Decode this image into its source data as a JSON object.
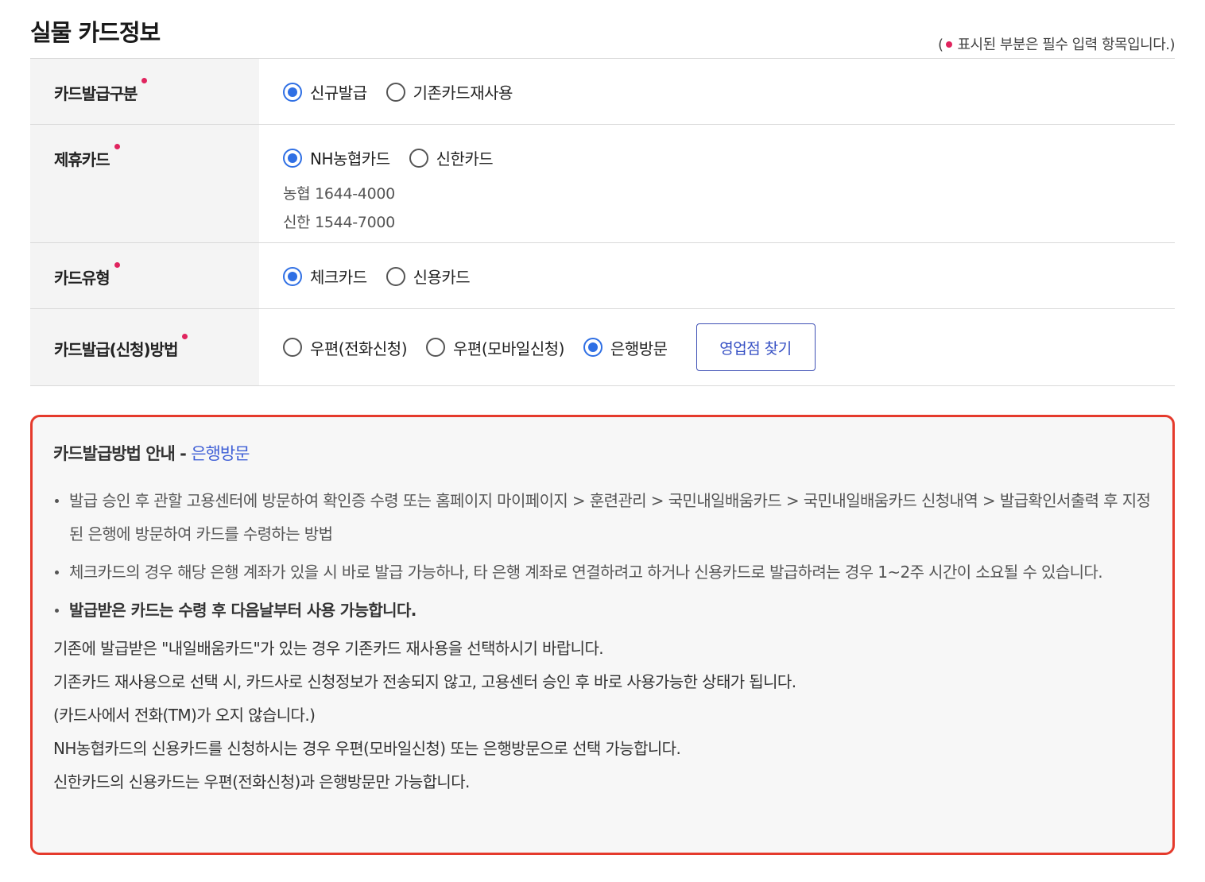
{
  "header": {
    "title": "실물 카드정보",
    "required_note_open": "(",
    "required_note_text": "표시된 부분은 필수 입력 항목입니다.)"
  },
  "form": {
    "issue_type": {
      "label": "카드발급구분",
      "options": [
        "신규발급",
        "기존카드재사용"
      ],
      "selected": "신규발급"
    },
    "partner_card": {
      "label": "제휴카드",
      "options": [
        "NH농협카드",
        "신한카드"
      ],
      "selected": "NH농협카드",
      "phones": [
        "농협 1644-4000",
        "신한 1544-7000"
      ]
    },
    "card_type": {
      "label": "카드유형",
      "options": [
        "체크카드",
        "신용카드"
      ],
      "selected": "체크카드"
    },
    "issue_method": {
      "label": "카드발급(신청)방법",
      "options": [
        "우편(전화신청)",
        "우편(모바일신청)",
        "은행방문"
      ],
      "selected": "은행방문",
      "branch_button": "영업점 찾기"
    }
  },
  "info": {
    "title_prefix": "카드발급방법 안내 -",
    "title_accent": "은행방문",
    "bullet1": "발급 승인 후 관할 고용센터에 방문하여 확인증 수령 또는 홈페이지 마이페이지 > 훈련관리 > 국민내일배움카드 > 국민내일배움카드 신청내역 > 발급확인서출력 후 지정된 은행에 방문하여 카드를 수령하는 방법",
    "bullet2": "체크카드의 경우 해당 은행 계좌가 있을 시 바로 발급 가능하나, 타 은행 계좌로 연결하려고 하거나 신용카드로 발급하려는 경우 1~2주 시간이 소요될 수 있습니다.",
    "bullet3": "발급받은 카드는 수령 후 다음날부터 사용 가능합니다.",
    "notes": [
      "기존에 발급받은 \"내일배움카드\"가 있는 경우 기존카드 재사용을 선택하시기 바랍니다.",
      "기존카드 재사용으로 선택 시, 카드사로 신청정보가 전송되지 않고, 고용센터 승인 후 바로 사용가능한 상태가 됩니다.",
      "(카드사에서 전화(TM)가 오지 않습니다.)",
      "NH농협카드의 신용카드를 신청하시는 경우 우편(모바일신청) 또는 은행방문으로 선택 가능합니다.",
      "신한카드의 신용카드는 우편(전화신청)과 은행방문만 가능합니다."
    ]
  },
  "colors": {
    "accent_blue": "#2f6fe4",
    "required_dot": "#e0245e",
    "info_border": "#e53a2c"
  }
}
